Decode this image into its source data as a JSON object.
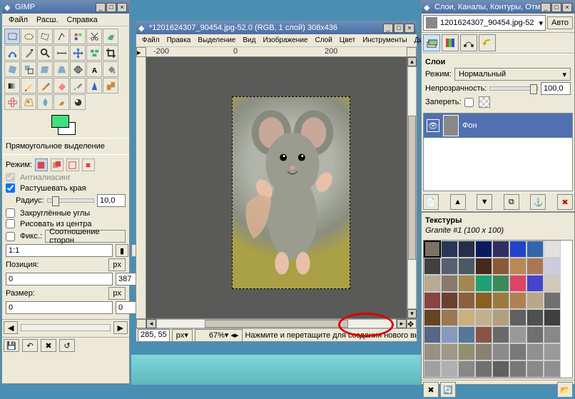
{
  "toolbox": {
    "title": "GIMP",
    "menu_file": "Файл",
    "menu_ext": "Расш.",
    "menu_help": "Справка",
    "tool_label": "Прямоугольное выделение",
    "mode_label": "Режим:",
    "antialias": "Антиалиасинг",
    "feather": "Растушевать края",
    "radius_label": "Радиус:",
    "radius_val": "10,0",
    "rounded": "Закруглённые углы",
    "center": "Рисовать из центра",
    "fixed_label": "Фикс.:",
    "fixed_val": "Соотношение сторон",
    "ratio": "1:1",
    "position_label": "Позиция:",
    "pos_unit": "px",
    "pos_x": "0",
    "pos_y": "387",
    "size_label": "Размер:",
    "size_unit": "px",
    "size_x": "0",
    "size_y": "0"
  },
  "imgwin": {
    "title": "*1201624307_90454.jpg-52.0 (RGB, 1 слой) 308x436",
    "menu_file": "Файл",
    "menu_edit": "Правка",
    "menu_select": "Выделение",
    "menu_view": "Вид",
    "menu_image": "Изображение",
    "menu_layer": "Слой",
    "menu_color": "Цвет",
    "menu_tools": "Инструменты",
    "menu_dialogs": "Диалоги",
    "ruler_neg200": "-200",
    "ruler_0": "0",
    "ruler_200": "200",
    "status_pos": "285, 55",
    "status_unit": "px",
    "status_zoom": "67%",
    "status_hint": "Нажмите и перетащите для создания нового выделе"
  },
  "layers": {
    "title": "Слои, Каналы, Контуры, Отме",
    "image_name": "1201624307_90454.jpg-52",
    "auto": "Авто",
    "section_layers": "Слои",
    "mode_label": "Режим:",
    "mode_val": "Нормальный",
    "opacity_label": "Непрозрачность:",
    "opacity_val": "100,0",
    "lock_label": "Запереть:",
    "layer_name": "Фон",
    "section_textures": "Текстуры",
    "texture_name": "Granite #1 (100 x 100)"
  },
  "textures": [
    "#7a7264",
    "#2a3658",
    "#253048",
    "#0a1a5e",
    "#303060",
    "#2244cc",
    "#3366aa",
    "#e0e0e0",
    "#404040",
    "#556070",
    "#4a5a64",
    "#442a1a",
    "#885a3a",
    "#bb8855",
    "#aa7755",
    "#ccccdd",
    "#b8aa94",
    "#887a6a",
    "#a08850",
    "#20a070",
    "#3a8a5a",
    "#dd4466",
    "#4444cc",
    "#d0c8b8",
    "#884444",
    "#6a4030",
    "#8a6040",
    "#886020",
    "#9a7a40",
    "#b08050",
    "#b8a888",
    "#707070",
    "#664422",
    "#9a7850",
    "#c8b080",
    "#c0b090",
    "#b0a080",
    "#606060",
    "#505050",
    "#404040",
    "#556688",
    "#8899bb",
    "#557799",
    "#885544",
    "#6a6a6a",
    "#999999",
    "#707070",
    "#888888",
    "#999080",
    "#a09888",
    "#909070",
    "#888070",
    "#8a8a8a",
    "#787878",
    "#909090",
    "#9a9a9a",
    "#a0a0a0",
    "#b0b0b0",
    "#888888",
    "#707070",
    "#606060",
    "#787878",
    "#8a8a8a",
    "#909090"
  ]
}
